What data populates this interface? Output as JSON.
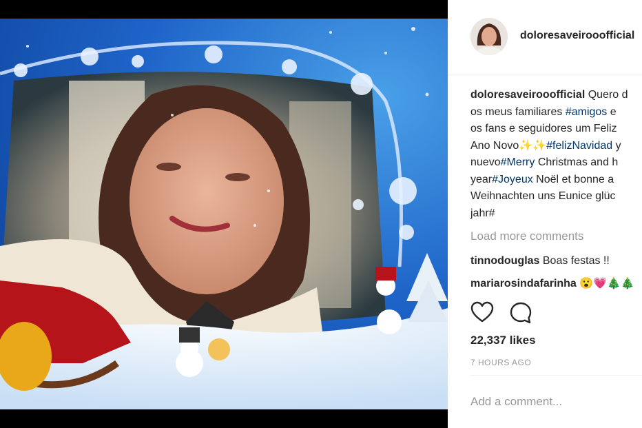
{
  "post": {
    "username": "doloresaveirooofficial",
    "caption_username": "doloresaveirooofficial",
    "caption_segments": [
      {
        "type": "text",
        "value": " Quero d"
      },
      {
        "type": "text",
        "value": "os meus familiares "
      },
      {
        "type": "tag",
        "value": "#amigos"
      },
      {
        "type": "text",
        "value": " e"
      },
      {
        "type": "text",
        "value": "os fans e seguidores um Feliz"
      },
      {
        "type": "text",
        "value": "Ano Novo"
      },
      {
        "type": "tag",
        "value": "#felizNavidad"
      },
      {
        "type": "text",
        "value": " y"
      },
      {
        "type": "text",
        "value": "nuevo"
      },
      {
        "type": "tag",
        "value": "#Merry"
      },
      {
        "type": "text",
        "value": " Christmas and h"
      },
      {
        "type": "text",
        "value": "year"
      },
      {
        "type": "tag",
        "value": "#Joyeux"
      },
      {
        "type": "text",
        "value": " Noël et bonne a"
      },
      {
        "type": "text",
        "value": "Weihnachten uns Eunice glüc"
      },
      {
        "type": "text",
        "value": "jahr#"
      }
    ],
    "load_more": "Load more comments",
    "comments": [
      {
        "username": "tinnodouglas",
        "text": " Boas festas !!"
      },
      {
        "username": "mariarosindafarinha",
        "text": " 😮💗🎄🎄"
      }
    ],
    "likes": "22,337 likes",
    "time": "7 HOURS AGO",
    "add_comment_placeholder": "Add a comment...",
    "icons": {
      "like": "heart-icon",
      "comment": "comment-bubble-icon"
    }
  },
  "colors": {
    "hashtag": "#003569",
    "muted": "#999999",
    "text": "#262626"
  }
}
